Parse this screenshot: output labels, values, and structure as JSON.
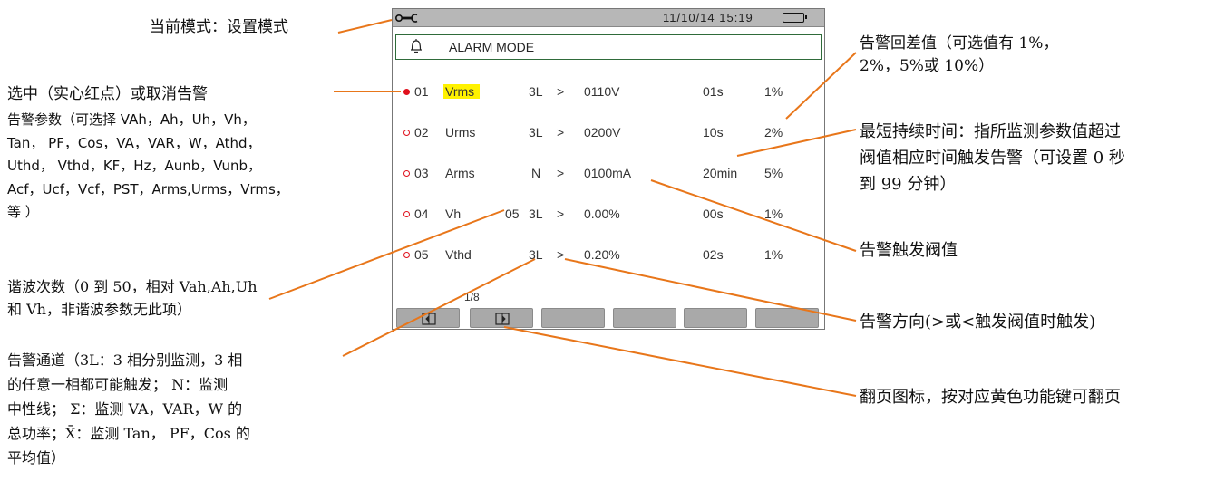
{
  "status_bar": {
    "date_time": "11/10/14  15:19",
    "mode_icon": "wrench-setup-icon",
    "battery_icon": "battery-icon"
  },
  "header": {
    "icon": "bell-icon",
    "title": "ALARM MODE"
  },
  "alarms": [
    {
      "index": "01",
      "enabled": true,
      "selected": true,
      "parameter": "Vrms",
      "harmonic": "",
      "channel": "3L",
      "direction": ">",
      "threshold": "0110V",
      "duration": "01s",
      "hysteresis": "1%"
    },
    {
      "index": "02",
      "enabled": false,
      "selected": false,
      "parameter": "Urms",
      "harmonic": "",
      "channel": "3L",
      "direction": ">",
      "threshold": "0200V",
      "duration": "10s",
      "hysteresis": "2%"
    },
    {
      "index": "03",
      "enabled": false,
      "selected": false,
      "parameter": "Arms",
      "harmonic": "",
      "channel": "N",
      "direction": ">",
      "threshold": "0100mA",
      "duration": "20min",
      "hysteresis": "5%"
    },
    {
      "index": "04",
      "enabled": false,
      "selected": false,
      "parameter": "Vh",
      "harmonic": "05",
      "channel": "3L",
      "direction": ">",
      "threshold": "0.00%",
      "duration": "00s",
      "hysteresis": "1%"
    },
    {
      "index": "05",
      "enabled": false,
      "selected": false,
      "parameter": "Vthd",
      "harmonic": "",
      "channel": "3L",
      "direction": ">",
      "threshold": "0.20%",
      "duration": "02s",
      "hysteresis": "1%"
    }
  ],
  "pager": "1/8",
  "function_keys": [
    {
      "icon": "page-prev-icon"
    },
    {
      "icon": "page-next-icon"
    },
    {
      "icon": ""
    },
    {
      "icon": ""
    },
    {
      "icon": ""
    },
    {
      "icon": ""
    }
  ],
  "annotations": {
    "current_mode": "当前模式：设置模式",
    "select_alarm": "选中（实心红点）或取消告警",
    "alarm_params": [
      "告警参数（可选择 VAh，Ah，Uh，Vh，",
      "Tan， PF，Cos，VA，VAR，W，Athd，",
      "Uthd， Vthd，KF，Hz，Aunb，Vunb，",
      "Acf，Ucf，Vcf，PST，Arms,Urms，Vrms，",
      "等 ）"
    ],
    "harmonic_order": [
      "谐波次数（0 到 50，相对 Vah,Ah,Uh",
      "和 Vh，非谐波参数无此项）"
    ],
    "alarm_channel": [
      "告警通道（3L：3 相分别监测，3 相",
      "的任意一相都可能触发； N：监测",
      "中性线； Σ：监测 VA，VAR，W 的",
      "总功率；X̄：监测 Tan， PF，Cos 的",
      "平均值）"
    ],
    "hysteresis": [
      "告警回差值（可选值有 1%，",
      "2%，5%或 10%）"
    ],
    "min_duration": [
      "最短持续时间：指所监测参数值超过",
      "阀值相应时间触发告警（可设置 0 秒",
      "到 99 分钟）"
    ],
    "threshold": "告警触发阀值",
    "direction": "告警方向(>或<触发阀值时触发)",
    "page_icon": "翻页图标，按对应黄色功能键可翻页"
  },
  "colors": {
    "leader_line": "#e8761a",
    "alarm_dot": "#e0101c",
    "selection_highlight": "#fff200",
    "title_border": "#2f6b3a",
    "status_bar": "#b7b7b7",
    "function_key": "#a9a9a9"
  }
}
